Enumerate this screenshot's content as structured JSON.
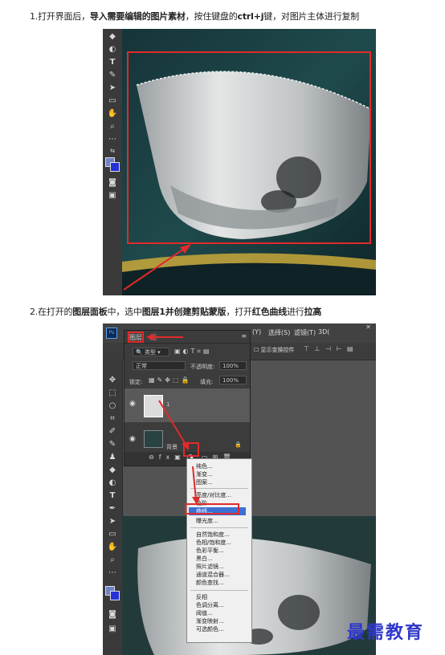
{
  "step1": {
    "prefix": "1.打开界面后，",
    "b1": "导入需要编辑的图片素材",
    "mid": "，按住键盘的",
    "b2": "ctrl+j",
    "suffix": "键，对图片主体进行复制"
  },
  "step2": {
    "prefix": "2.在打开的",
    "b1": "图层面板",
    "mid1": "中，选中",
    "b2": "图层1并创建剪贴蒙版",
    "mid2": "，打开",
    "b3": "红色曲线",
    "mid3": "进行",
    "b4": "拉高"
  },
  "tools_icons": [
    "eraser-icon",
    "gradient-icon",
    "type-icon",
    "pen-icon",
    "select-arrow-icon",
    "rectangle-icon",
    "hand-icon",
    "zoom-icon",
    "more-icon",
    "swap-colors-icon",
    "color-swatch-icon",
    "quick-mask-icon",
    "screen-mode-icon"
  ],
  "layers_panel": {
    "tab_layers": "图层",
    "tab_other": "图",
    "filter_kind": "类型",
    "blend_mode": "正常",
    "opacity_label": "不透明度:",
    "opacity_value": "100%",
    "lock_label": "锁定:",
    "fill_label": "填充:",
    "fill_value": "100%",
    "layer1_name": "1",
    "background_name": "背景"
  },
  "ps_topbar": {
    "menu1": "(Y)",
    "menu2": "选择(S)",
    "menu3": "滤镜(T)",
    "menu4": "3D(",
    "option": "显示变换控件"
  },
  "adjust_menu": {
    "group1": [
      "纯色...",
      "渐变...",
      "图案..."
    ],
    "group2": [
      "亮度/对比度...",
      "色阶...",
      "曲线...",
      "曝光度..."
    ],
    "group3": [
      "自然饱和度...",
      "色相/饱和度...",
      "色彩平衡...",
      "黑白...",
      "照片滤镜...",
      "通道混合器...",
      "颜色查找..."
    ],
    "group4": [
      "反相",
      "色调分离...",
      "阈值...",
      "渐变映射...",
      "可选颜色..."
    ],
    "highlighted": "曲线..."
  },
  "watermark": "最需教育",
  "colors": {
    "red_annotation": "#e12a2a",
    "highlight_blue": "#3b6fd4",
    "watermark_blue": "#2f38c9"
  }
}
